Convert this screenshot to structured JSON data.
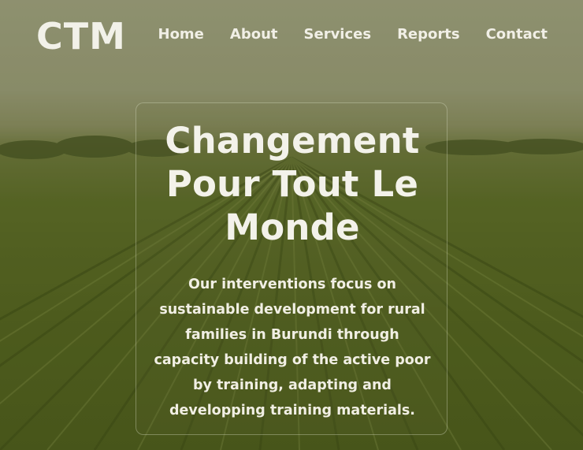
{
  "header": {
    "logo": "CTM",
    "nav": [
      {
        "label": "Home"
      },
      {
        "label": "About"
      },
      {
        "label": "Services"
      },
      {
        "label": "Reports"
      },
      {
        "label": "Contact"
      }
    ]
  },
  "hero": {
    "title": "Changement Pour Tout Le Monde",
    "description": "Our interventions focus on sustainable development for rural families in Burundi through capacity building of the active poor by training, adapting and developping training materials."
  },
  "colors": {
    "text": "#f2f1e9",
    "overlay": "#6b7340",
    "field": "#56661f"
  }
}
